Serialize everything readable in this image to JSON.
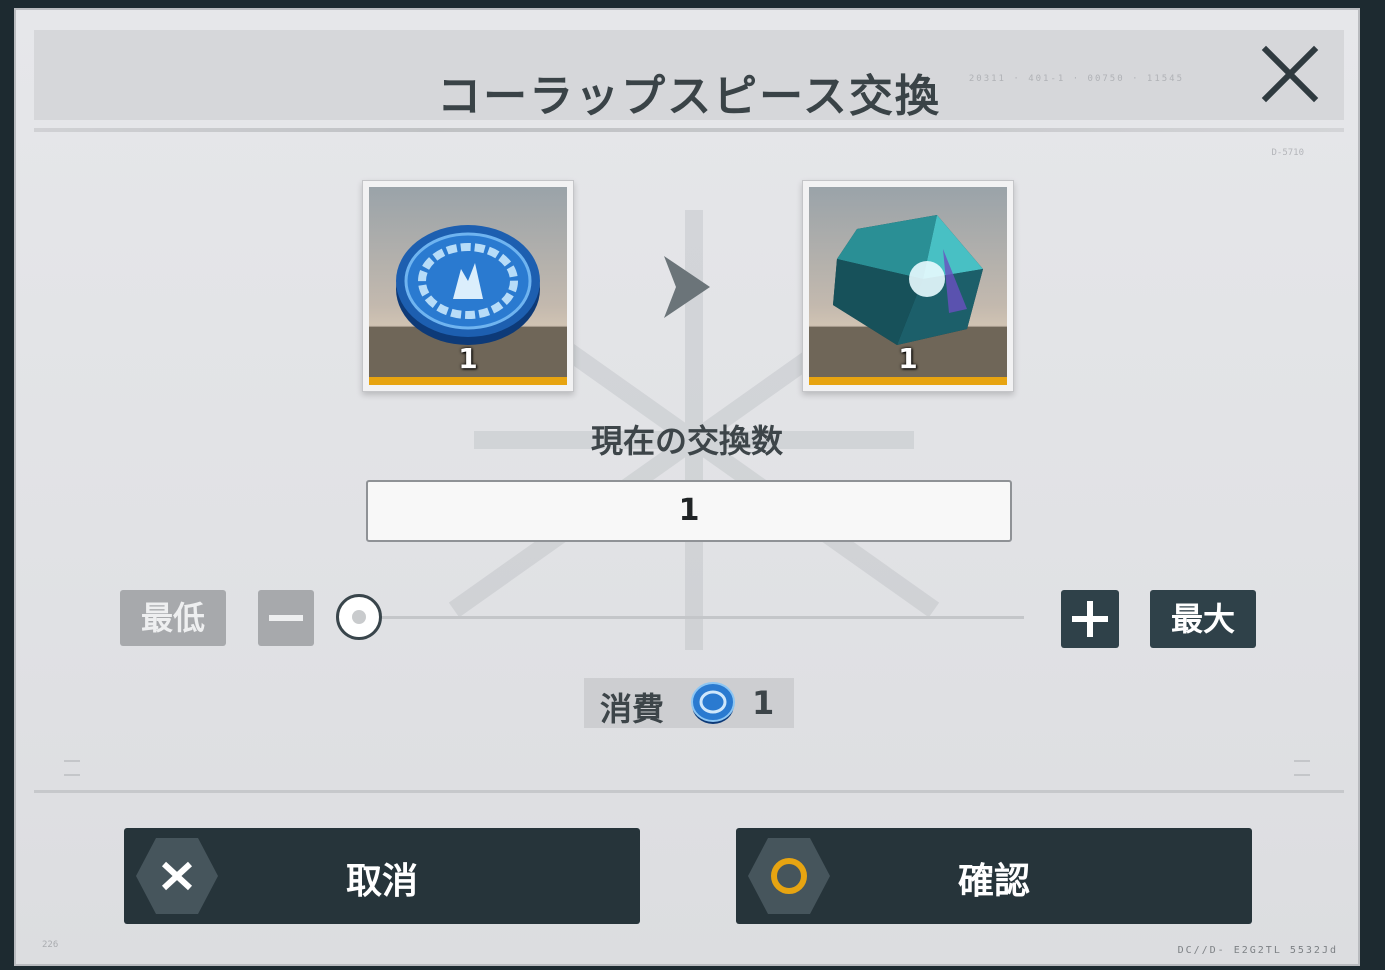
{
  "dialog": {
    "title": "コーラップスピース交換",
    "header_code": "20311 · 401-1 · 00750 · 11545",
    "corner_code": "D-5710",
    "bottom_code": "DC//D- E2G2TL 5532Jd",
    "bottom_left_code": "226"
  },
  "exchange": {
    "source_item": {
      "icon": "blue-medal-coin-icon",
      "count": "1",
      "rarity_color": "#e7a411"
    },
    "target_item": {
      "icon": "collapse-piece-crystal-icon",
      "count": "1",
      "rarity_color": "#e7a411"
    },
    "arrow_icon": "chevron-right-icon"
  },
  "quantity": {
    "label": "現在の交換数",
    "value": "1",
    "min_label": "最低",
    "max_label": "最大",
    "slider_level": 0
  },
  "cost": {
    "label": "消費",
    "icon": "blue-medal-coin-icon",
    "value": "1"
  },
  "actions": {
    "cancel_label": "取消",
    "confirm_label": "確認",
    "cancel_icon": "x-icon",
    "confirm_icon": "circle-icon",
    "accent": "#e7a411"
  },
  "colors": {
    "panel_bg": "#e3e4e7",
    "dark_button": "#2f4149",
    "disabled_button": "#a7a9ac",
    "text": "#3d4549"
  }
}
